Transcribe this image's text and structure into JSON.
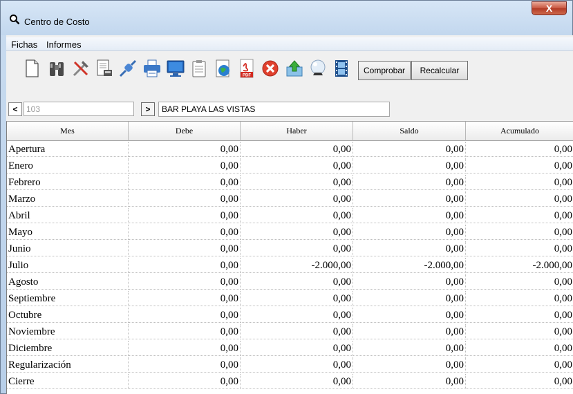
{
  "window": {
    "title": "Centro de Costo",
    "close_label": "X"
  },
  "menu": {
    "items": [
      "Fichas",
      "Informes"
    ]
  },
  "toolbar": {
    "icons": [
      "new-document-icon",
      "binoculars-icon",
      "tools-icon",
      "print-preview-icon",
      "connect-icon",
      "printer-icon",
      "monitor-icon",
      "clipboard-icon",
      "web-icon",
      "pdf-icon",
      "cancel-icon",
      "export-icon",
      "crystal-ball-icon",
      "film-icon"
    ],
    "comprobar_label": "Comprobar",
    "recalcular_label": "Recalcular"
  },
  "record": {
    "nav_prev": "<",
    "code": "103",
    "nav_next": ">",
    "name": "BAR PLAYA LAS VISTAS"
  },
  "grid": {
    "columns": [
      "Mes",
      "Debe",
      "Haber",
      "Saldo",
      "Acumulado"
    ],
    "rows": [
      {
        "mes": "Apertura",
        "debe": "0,00",
        "haber": "0,00",
        "saldo": "0,00",
        "acumulado": "0,00"
      },
      {
        "mes": "Enero",
        "debe": "0,00",
        "haber": "0,00",
        "saldo": "0,00",
        "acumulado": "0,00"
      },
      {
        "mes": "Febrero",
        "debe": "0,00",
        "haber": "0,00",
        "saldo": "0,00",
        "acumulado": "0,00"
      },
      {
        "mes": "Marzo",
        "debe": "0,00",
        "haber": "0,00",
        "saldo": "0,00",
        "acumulado": "0,00"
      },
      {
        "mes": "Abril",
        "debe": "0,00",
        "haber": "0,00",
        "saldo": "0,00",
        "acumulado": "0,00"
      },
      {
        "mes": "Mayo",
        "debe": "0,00",
        "haber": "0,00",
        "saldo": "0,00",
        "acumulado": "0,00"
      },
      {
        "mes": "Junio",
        "debe": "0,00",
        "haber": "0,00",
        "saldo": "0,00",
        "acumulado": "0,00"
      },
      {
        "mes": "Julio",
        "debe": "0,00",
        "haber": "-2.000,00",
        "saldo": "-2.000,00",
        "acumulado": "-2.000,00"
      },
      {
        "mes": "Agosto",
        "debe": "0,00",
        "haber": "0,00",
        "saldo": "0,00",
        "acumulado": "0,00"
      },
      {
        "mes": "Septiembre",
        "debe": "0,00",
        "haber": "0,00",
        "saldo": "0,00",
        "acumulado": "0,00"
      },
      {
        "mes": "Octubre",
        "debe": "0,00",
        "haber": "0,00",
        "saldo": "0,00",
        "acumulado": "0,00"
      },
      {
        "mes": "Noviembre",
        "debe": "0,00",
        "haber": "0,00",
        "saldo": "0,00",
        "acumulado": "0,00"
      },
      {
        "mes": "Diciembre",
        "debe": "0,00",
        "haber": "0,00",
        "saldo": "0,00",
        "acumulado": "0,00"
      },
      {
        "mes": "Regularización",
        "debe": "0,00",
        "haber": "0,00",
        "saldo": "0,00",
        "acumulado": "0,00"
      },
      {
        "mes": "Cierre",
        "debe": "0,00",
        "haber": "0,00",
        "saldo": "0,00",
        "acumulado": "0,00"
      }
    ]
  }
}
